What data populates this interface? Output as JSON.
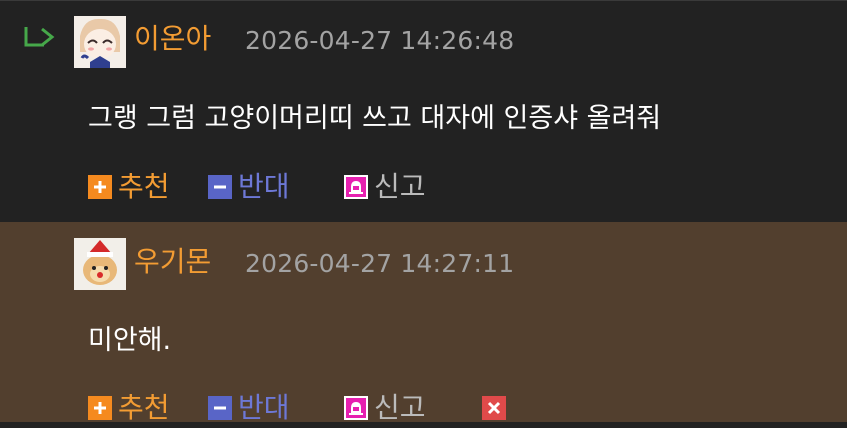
{
  "comments": [
    {
      "nickname": "이온아",
      "timestamp": "2026-04-27 14:26:48",
      "text": "그랭 그럼 고양이머리띠 쓰고 대자에 인증샤 올려줘",
      "actions": {
        "upvote": "추천",
        "downvote": "반대",
        "report": "신고"
      }
    },
    {
      "nickname": "우기몬",
      "timestamp": "2026-04-27 14:27:11",
      "text": "미안해.",
      "actions": {
        "upvote": "추천",
        "downvote": "반대",
        "report": "신고"
      }
    }
  ],
  "icons": {
    "reply": "reply-arrow-icon",
    "upvote": "plus-icon",
    "downvote": "minus-icon",
    "report": "siren-icon",
    "delete": "close-icon"
  },
  "colors": {
    "nickname": "#f39c33",
    "upvote": "#f58a1f",
    "downvote": "#5965c7",
    "report": "#e620b0",
    "delete": "#e04a4a",
    "reply_bg": "#222222",
    "comment_bg": "#523f2e"
  }
}
